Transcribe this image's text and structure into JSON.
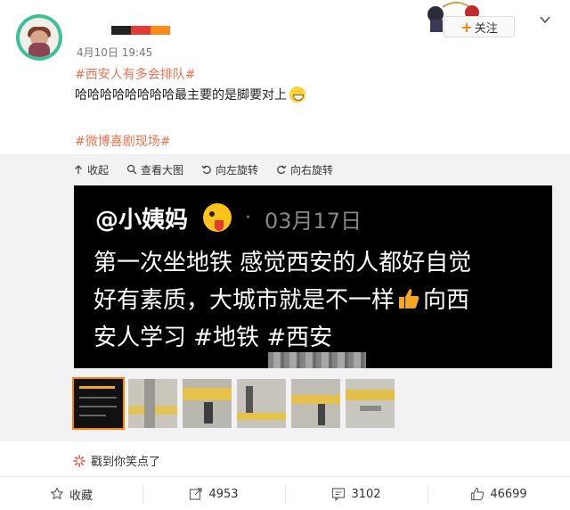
{
  "post": {
    "time": "4月10日 19:45",
    "topic1": "#西安人有多会排队#",
    "text": "哈哈哈哈哈哈哈哈最主要的是脚要对上",
    "topic2": "#微博喜剧现场#"
  },
  "follow_button": {
    "label": "关注"
  },
  "toolbar": {
    "collapse": "收起",
    "view_large": "查看大图",
    "rotate_left": "向左旋转",
    "rotate_right": "向右旋转"
  },
  "image": {
    "handle": "@小姨妈",
    "dot": "·",
    "date": "03月17日",
    "line1": "第一次坐地铁 感觉西安的人都好自觉",
    "line2a": "好有素质，大城市就是不一样",
    "line2b": "向西",
    "line3": "安人学习 #地铁 #西安"
  },
  "reaction": {
    "label": "戳到你笑点了"
  },
  "actions": {
    "favorite": "收藏",
    "repost": "4953",
    "comment": "3102",
    "like": "46699"
  },
  "colors": {
    "topic": "#eb7350",
    "accent": "#ff8200",
    "panel": "#f2f2f5"
  }
}
